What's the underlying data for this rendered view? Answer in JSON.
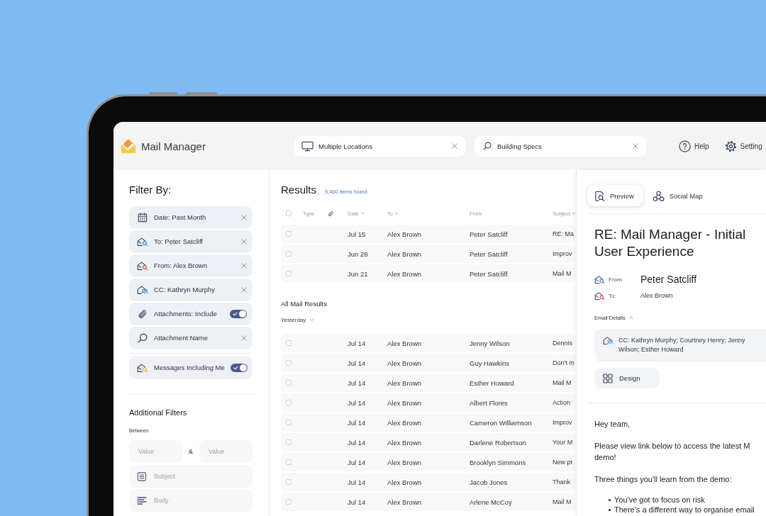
{
  "app": {
    "title": "Mail Manager"
  },
  "header": {
    "location_field": {
      "value": "Multiple Locations"
    },
    "search_field": {
      "value": "Building Specs"
    },
    "links": [
      {
        "kind": "help",
        "label": "Help"
      },
      {
        "kind": "settings",
        "label": "Setting"
      }
    ]
  },
  "filter_panel": {
    "title": "Filter By:",
    "filters": [
      {
        "kind": "removable",
        "label": "Date: Past Month"
      },
      {
        "kind": "removable",
        "label": "To: Peter Satcliff"
      },
      {
        "kind": "removable",
        "label": "From: Alex Brown"
      },
      {
        "kind": "removable",
        "label": "CC: Kathryn Murphy"
      },
      {
        "kind": "toggle",
        "label": "Attachments: Include",
        "on": true
      },
      {
        "kind": "removable",
        "label": "Attachment Name"
      }
    ],
    "personal_filter": {
      "label": "Messages Including Me",
      "on": true
    },
    "additional_filters": {
      "title": "Additional Filters",
      "range_label": "Between",
      "range_from": {
        "placeholder": "Value"
      },
      "range_separator": "&",
      "range_to": {
        "placeholder": "Value"
      },
      "fields": [
        {
          "kind": "subject",
          "placeholder": "Subject"
        },
        {
          "kind": "body",
          "placeholder": "Body"
        }
      ]
    }
  },
  "results": {
    "title": "Results",
    "count": "5,460 items found",
    "select_all": {
      "checked": false
    },
    "columns": [
      {
        "kind": "text",
        "label": "Type"
      },
      {
        "kind": "attachment"
      },
      {
        "kind": "text",
        "label": "Date",
        "ascending": false
      },
      {
        "kind": "text",
        "label": "To",
        "ascending": true
      },
      {
        "kind": "text",
        "label": "From"
      },
      {
        "kind": "text",
        "label": "Subject",
        "ascending": false
      }
    ],
    "pinned_rows": [
      {
        "checked": false,
        "date": "Jul 15",
        "to": "Alex Brown",
        "from": "Peter Satcliff",
        "subject": "RE: Ma"
      },
      {
        "checked": false,
        "date": "Jun 28",
        "to": "Alex Brown",
        "from": "Peter Satcliff",
        "subject": "Improv"
      },
      {
        "checked": false,
        "date": "Jun 21",
        "to": "Alex Brown",
        "from": "Peter Satcliff",
        "subject": "Mail M"
      }
    ],
    "group": {
      "title": "All Mail Results",
      "period": "Yesterday"
    },
    "rows": [
      {
        "checked": false,
        "date": "Jul 14",
        "to": "Alex Brown",
        "from": "Jenny Wilson",
        "subject": "Dennis"
      },
      {
        "checked": false,
        "date": "Jul 14",
        "to": "Alex Brown",
        "from": "Guy Hawkins",
        "subject": "Don't m"
      },
      {
        "checked": false,
        "date": "Jul 14",
        "to": "Alex Brown",
        "from": "Esther Howard",
        "subject": "Mail M"
      },
      {
        "checked": false,
        "date": "Jul 14",
        "to": "Alex Brown",
        "from": "Albert Flores",
        "subject": "Action"
      },
      {
        "checked": false,
        "date": "Jul 14",
        "to": "Alex Brown",
        "from": "Cameron Williamson",
        "subject": "Improv"
      },
      {
        "checked": false,
        "date": "Jul 14",
        "to": "Alex Brown",
        "from": "Darlene Robertson",
        "subject": "Your M"
      },
      {
        "checked": false,
        "date": "Jul 14",
        "to": "Alex Brown",
        "from": "Brooklyn Simmons",
        "subject": "New pr"
      },
      {
        "checked": false,
        "date": "Jul 14",
        "to": "Alex Brown",
        "from": "Jacob Jones",
        "subject": "Thank"
      },
      {
        "checked": false,
        "date": "Jul 14",
        "to": "Alex Brown",
        "from": "Arlene McCoy",
        "subject": "Mail M"
      }
    ]
  },
  "preview": {
    "tabs": [
      {
        "kind": "preview",
        "label": "Preview",
        "selected": true
      },
      {
        "kind": "social_map",
        "label": "Social Map",
        "selected": false
      }
    ],
    "subject": "RE: Mail Manager - Initial User Experience",
    "from": {
      "label": "From:",
      "name": "Peter Satcliff"
    },
    "to": {
      "label": "To:",
      "name": "Alex Brown"
    },
    "details": {
      "label": "Email Details",
      "expanded": true,
      "cc": "CC: Kathryn Murphy; Courtney Henry; Jenny Wilson; Esther Howard"
    },
    "category": "Design",
    "body": [
      {
        "kind": "paragraph",
        "lines": [
          "Hey team,"
        ]
      },
      {
        "kind": "paragraph",
        "lines": [
          "Please view link below to access the latest M",
          "demo!"
        ]
      },
      {
        "kind": "paragraph",
        "lines": [
          "Three things you'll learn from the demo:"
        ]
      },
      {
        "kind": "bullets",
        "items": [
          "You've got to focus on risk",
          "There's a different way to organise email"
        ]
      }
    ]
  }
}
